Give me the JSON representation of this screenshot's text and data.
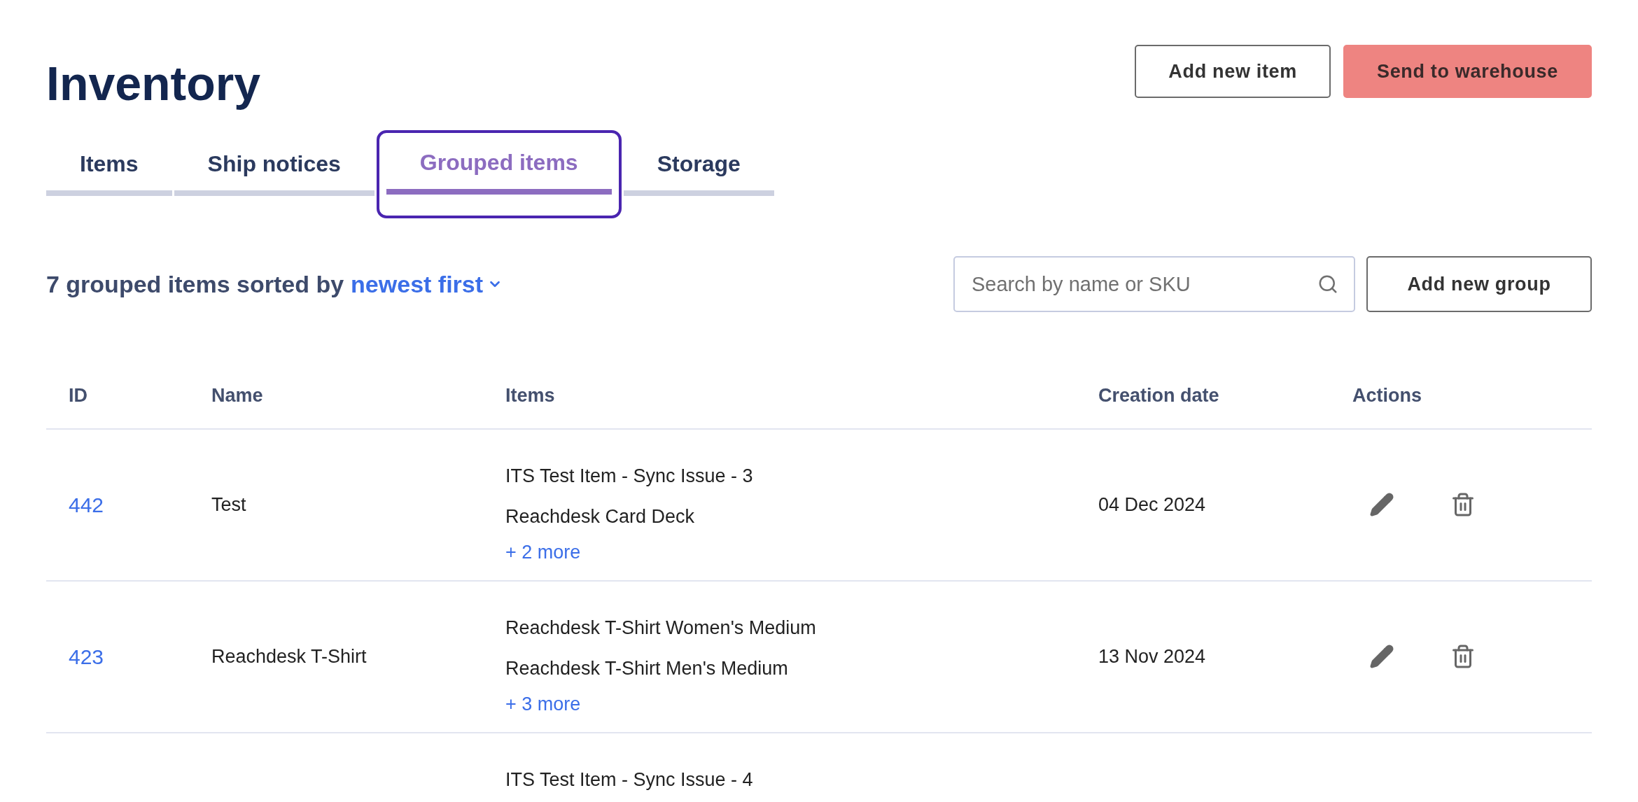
{
  "page": {
    "title": "Inventory"
  },
  "header_buttons": [
    {
      "label": "Add new item",
      "kind": "outline"
    },
    {
      "label": "Send to warehouse",
      "kind": "primary"
    }
  ],
  "tabs": [
    {
      "label": "Items",
      "selected": false
    },
    {
      "label": "Ship notices",
      "selected": false
    },
    {
      "label": "Grouped items",
      "selected": true,
      "focused": true
    },
    {
      "label": "Storage",
      "selected": false
    }
  ],
  "summary": {
    "text": "7 grouped items sorted by",
    "sort": "newest first"
  },
  "search": {
    "placeholder": "Search by name or SKU"
  },
  "add_group_button": "Add new group",
  "table": {
    "columns": [
      "ID",
      "Name",
      "Items",
      "Creation date",
      "Actions"
    ],
    "rows": [
      {
        "id": "442",
        "name": "Test",
        "items": [
          "ITS Test Item - Sync Issue - 3",
          "Reachdesk Card Deck"
        ],
        "more": "+ 2 more",
        "date": "04 Dec 2024"
      },
      {
        "id": "423",
        "name": "Reachdesk T-Shirt",
        "items": [
          "Reachdesk T-Shirt Women's Medium",
          "Reachdesk T-Shirt Men's Medium"
        ],
        "more": "+ 3 more",
        "date": "13 Nov 2024"
      },
      {
        "items": [
          "ITS Test Item - Sync Issue - 4"
        ]
      }
    ]
  }
}
